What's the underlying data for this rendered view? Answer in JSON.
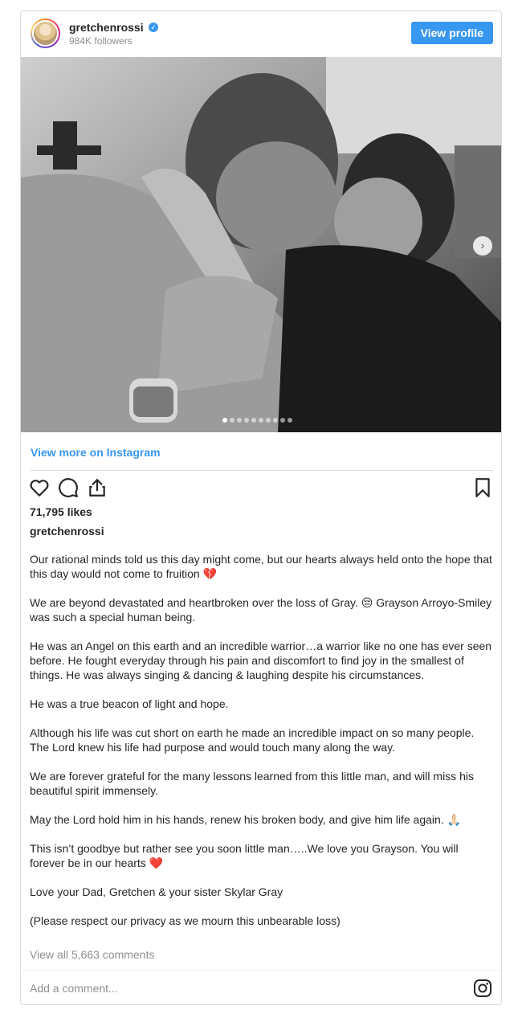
{
  "post": {
    "username": "gretchenrossi",
    "followers": "984K followers",
    "view_profile_label": "View profile",
    "view_more_label": "View more on Instagram",
    "likes": "71,795 likes",
    "caption_username": "gretchenrossi",
    "caption": [
      "Our rational minds told us this day might come, but our hearts always held onto the hope that this day would not come to fruition 💔",
      "We are beyond devastated and heartbroken over the loss of Gray. 😔 Grayson Arroyo-Smiley was such a special human being.",
      "He was an Angel on this earth and an incredible warrior…a warrior like no one has ever seen before. He fought everyday through his pain and discomfort to find joy in the smallest of things. He was always singing & dancing & laughing despite his circumstances.",
      "He was a true beacon of light and hope.",
      "Although his life was cut short on earth he made an incredible impact on so many people. The Lord knew his life had purpose and would touch many along the way.",
      "We are forever grateful for the many lessons learned from this little man, and will miss his beautiful spirit immensely.",
      "May the Lord hold him in his hands, renew his broken body, and give him life again. 🙏🏻",
      "This isn’t goodbye but rather see you soon little man…..We love you Grayson. You will forever be in our hearts ❤️",
      "Love your Dad, Gretchen & your sister Skylar Gray",
      "(Please respect our privacy as we mourn this unbearable loss)"
    ],
    "view_comments": "View all 5,663 comments",
    "comment_placeholder": "Add a comment...",
    "carousel": {
      "slide_count": 10,
      "active_index": 0
    }
  },
  "colors": {
    "accent": "#3897f0",
    "muted": "#8e8e8e",
    "text": "#262626",
    "border": "#dbdbdb"
  },
  "icons": [
    "verified-badge-icon",
    "heart-icon",
    "comment-icon",
    "share-icon",
    "bookmark-icon",
    "chevron-right-icon",
    "instagram-icon"
  ]
}
